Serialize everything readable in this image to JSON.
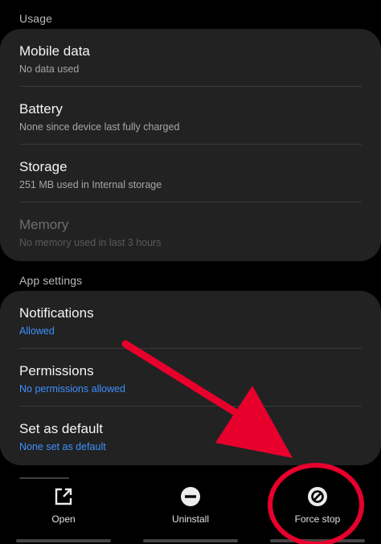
{
  "usage": {
    "header": "Usage",
    "items": [
      {
        "title": "Mobile data",
        "subtitle": "No data used"
      },
      {
        "title": "Battery",
        "subtitle": "None since device last fully charged"
      },
      {
        "title": "Storage",
        "subtitle": "251 MB used in Internal storage"
      },
      {
        "title": "Memory",
        "subtitle": "No memory used in last 3 hours",
        "disabled": true
      }
    ]
  },
  "app_settings": {
    "header": "App settings",
    "items": [
      {
        "title": "Notifications",
        "subtitle": "Allowed"
      },
      {
        "title": "Permissions",
        "subtitle": "No permissions allowed"
      },
      {
        "title": "Set as default",
        "subtitle": "None set as default"
      }
    ]
  },
  "bottom_actions": [
    {
      "label": "Open",
      "icon": "open-external-icon"
    },
    {
      "label": "Uninstall",
      "icon": "minus-circle-icon"
    },
    {
      "label": "Force stop",
      "icon": "block-icon"
    }
  ],
  "colors": {
    "background": "#000000",
    "card": "#222222",
    "accent_link": "#3e91ff",
    "annotation": "#e8002d"
  }
}
